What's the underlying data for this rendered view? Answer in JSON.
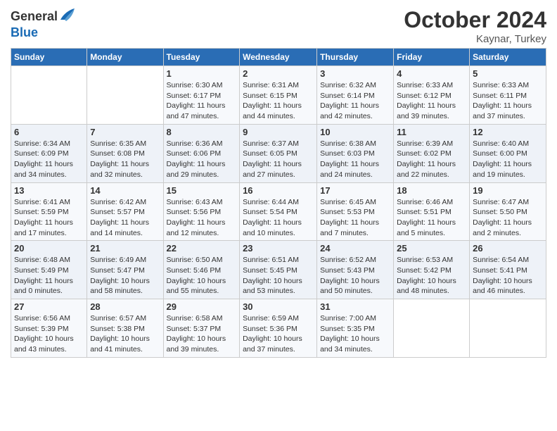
{
  "header": {
    "logo_general": "General",
    "logo_blue": "Blue",
    "month_title": "October 2024",
    "location": "Kaynar, Turkey"
  },
  "weekdays": [
    "Sunday",
    "Monday",
    "Tuesday",
    "Wednesday",
    "Thursday",
    "Friday",
    "Saturday"
  ],
  "weeks": [
    [
      {
        "day": "",
        "content": ""
      },
      {
        "day": "",
        "content": ""
      },
      {
        "day": "1",
        "content": "Sunrise: 6:30 AM\nSunset: 6:17 PM\nDaylight: 11 hours and 47 minutes."
      },
      {
        "day": "2",
        "content": "Sunrise: 6:31 AM\nSunset: 6:15 PM\nDaylight: 11 hours and 44 minutes."
      },
      {
        "day": "3",
        "content": "Sunrise: 6:32 AM\nSunset: 6:14 PM\nDaylight: 11 hours and 42 minutes."
      },
      {
        "day": "4",
        "content": "Sunrise: 6:33 AM\nSunset: 6:12 PM\nDaylight: 11 hours and 39 minutes."
      },
      {
        "day": "5",
        "content": "Sunrise: 6:33 AM\nSunset: 6:11 PM\nDaylight: 11 hours and 37 minutes."
      }
    ],
    [
      {
        "day": "6",
        "content": "Sunrise: 6:34 AM\nSunset: 6:09 PM\nDaylight: 11 hours and 34 minutes."
      },
      {
        "day": "7",
        "content": "Sunrise: 6:35 AM\nSunset: 6:08 PM\nDaylight: 11 hours and 32 minutes."
      },
      {
        "day": "8",
        "content": "Sunrise: 6:36 AM\nSunset: 6:06 PM\nDaylight: 11 hours and 29 minutes."
      },
      {
        "day": "9",
        "content": "Sunrise: 6:37 AM\nSunset: 6:05 PM\nDaylight: 11 hours and 27 minutes."
      },
      {
        "day": "10",
        "content": "Sunrise: 6:38 AM\nSunset: 6:03 PM\nDaylight: 11 hours and 24 minutes."
      },
      {
        "day": "11",
        "content": "Sunrise: 6:39 AM\nSunset: 6:02 PM\nDaylight: 11 hours and 22 minutes."
      },
      {
        "day": "12",
        "content": "Sunrise: 6:40 AM\nSunset: 6:00 PM\nDaylight: 11 hours and 19 minutes."
      }
    ],
    [
      {
        "day": "13",
        "content": "Sunrise: 6:41 AM\nSunset: 5:59 PM\nDaylight: 11 hours and 17 minutes."
      },
      {
        "day": "14",
        "content": "Sunrise: 6:42 AM\nSunset: 5:57 PM\nDaylight: 11 hours and 14 minutes."
      },
      {
        "day": "15",
        "content": "Sunrise: 6:43 AM\nSunset: 5:56 PM\nDaylight: 11 hours and 12 minutes."
      },
      {
        "day": "16",
        "content": "Sunrise: 6:44 AM\nSunset: 5:54 PM\nDaylight: 11 hours and 10 minutes."
      },
      {
        "day": "17",
        "content": "Sunrise: 6:45 AM\nSunset: 5:53 PM\nDaylight: 11 hours and 7 minutes."
      },
      {
        "day": "18",
        "content": "Sunrise: 6:46 AM\nSunset: 5:51 PM\nDaylight: 11 hours and 5 minutes."
      },
      {
        "day": "19",
        "content": "Sunrise: 6:47 AM\nSunset: 5:50 PM\nDaylight: 11 hours and 2 minutes."
      }
    ],
    [
      {
        "day": "20",
        "content": "Sunrise: 6:48 AM\nSunset: 5:49 PM\nDaylight: 11 hours and 0 minutes."
      },
      {
        "day": "21",
        "content": "Sunrise: 6:49 AM\nSunset: 5:47 PM\nDaylight: 10 hours and 58 minutes."
      },
      {
        "day": "22",
        "content": "Sunrise: 6:50 AM\nSunset: 5:46 PM\nDaylight: 10 hours and 55 minutes."
      },
      {
        "day": "23",
        "content": "Sunrise: 6:51 AM\nSunset: 5:45 PM\nDaylight: 10 hours and 53 minutes."
      },
      {
        "day": "24",
        "content": "Sunrise: 6:52 AM\nSunset: 5:43 PM\nDaylight: 10 hours and 50 minutes."
      },
      {
        "day": "25",
        "content": "Sunrise: 6:53 AM\nSunset: 5:42 PM\nDaylight: 10 hours and 48 minutes."
      },
      {
        "day": "26",
        "content": "Sunrise: 6:54 AM\nSunset: 5:41 PM\nDaylight: 10 hours and 46 minutes."
      }
    ],
    [
      {
        "day": "27",
        "content": "Sunrise: 6:56 AM\nSunset: 5:39 PM\nDaylight: 10 hours and 43 minutes."
      },
      {
        "day": "28",
        "content": "Sunrise: 6:57 AM\nSunset: 5:38 PM\nDaylight: 10 hours and 41 minutes."
      },
      {
        "day": "29",
        "content": "Sunrise: 6:58 AM\nSunset: 5:37 PM\nDaylight: 10 hours and 39 minutes."
      },
      {
        "day": "30",
        "content": "Sunrise: 6:59 AM\nSunset: 5:36 PM\nDaylight: 10 hours and 37 minutes."
      },
      {
        "day": "31",
        "content": "Sunrise: 7:00 AM\nSunset: 5:35 PM\nDaylight: 10 hours and 34 minutes."
      },
      {
        "day": "",
        "content": ""
      },
      {
        "day": "",
        "content": ""
      }
    ]
  ]
}
